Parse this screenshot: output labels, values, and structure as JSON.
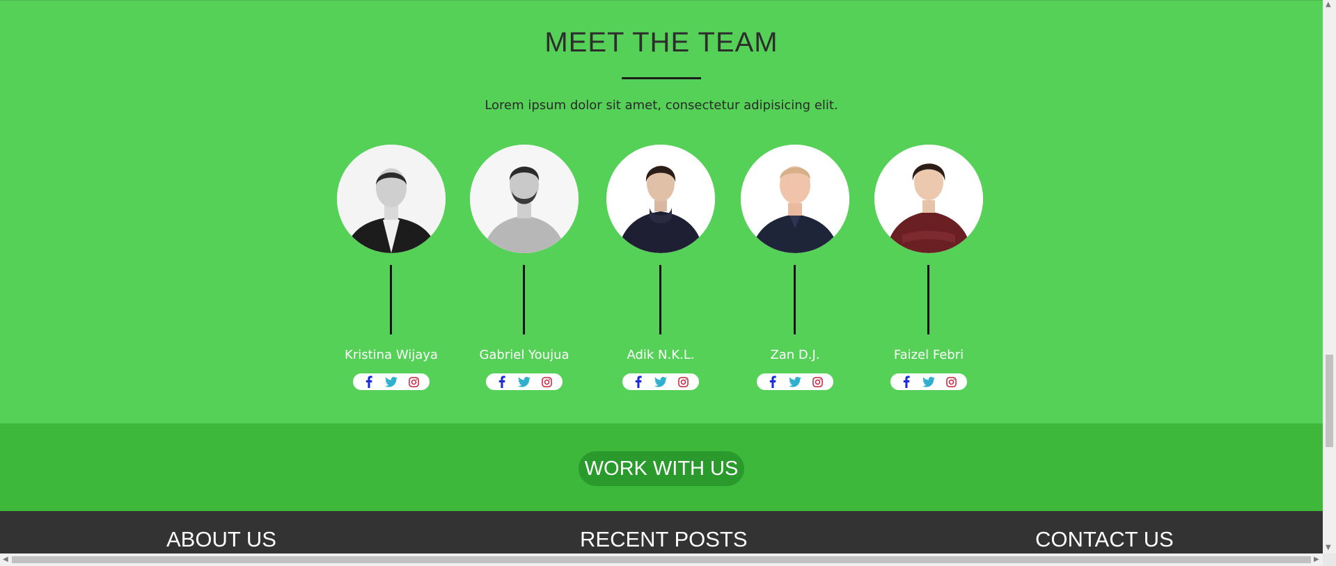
{
  "team_section": {
    "title": "MEET THE TEAM",
    "subtitle": "Lorem ipsum dolor sit amet, consectetur adipisicing elit.",
    "members": [
      {
        "name": "Kristina Wijaya"
      },
      {
        "name": "Gabriel Youjua"
      },
      {
        "name": "Adik N.K.L."
      },
      {
        "name": "Zan D.J."
      },
      {
        "name": "Faizel Febri"
      }
    ]
  },
  "cta": {
    "label": "WORK WITH US"
  },
  "footer": {
    "about_heading": "ABOUT US",
    "posts_heading": "RECENT POSTS",
    "contact_heading": "CONTACT US"
  },
  "colors": {
    "team_bg": "#55d157",
    "cta_band_bg": "#3db83b",
    "cta_button_bg": "#2a9a2d",
    "footer_bg": "#333333",
    "facebook": "#1a2dd8",
    "twitter": "#2fb0cf",
    "instagram": "#c8203a"
  },
  "icons": [
    "facebook-icon",
    "twitter-icon",
    "instagram-icon"
  ]
}
